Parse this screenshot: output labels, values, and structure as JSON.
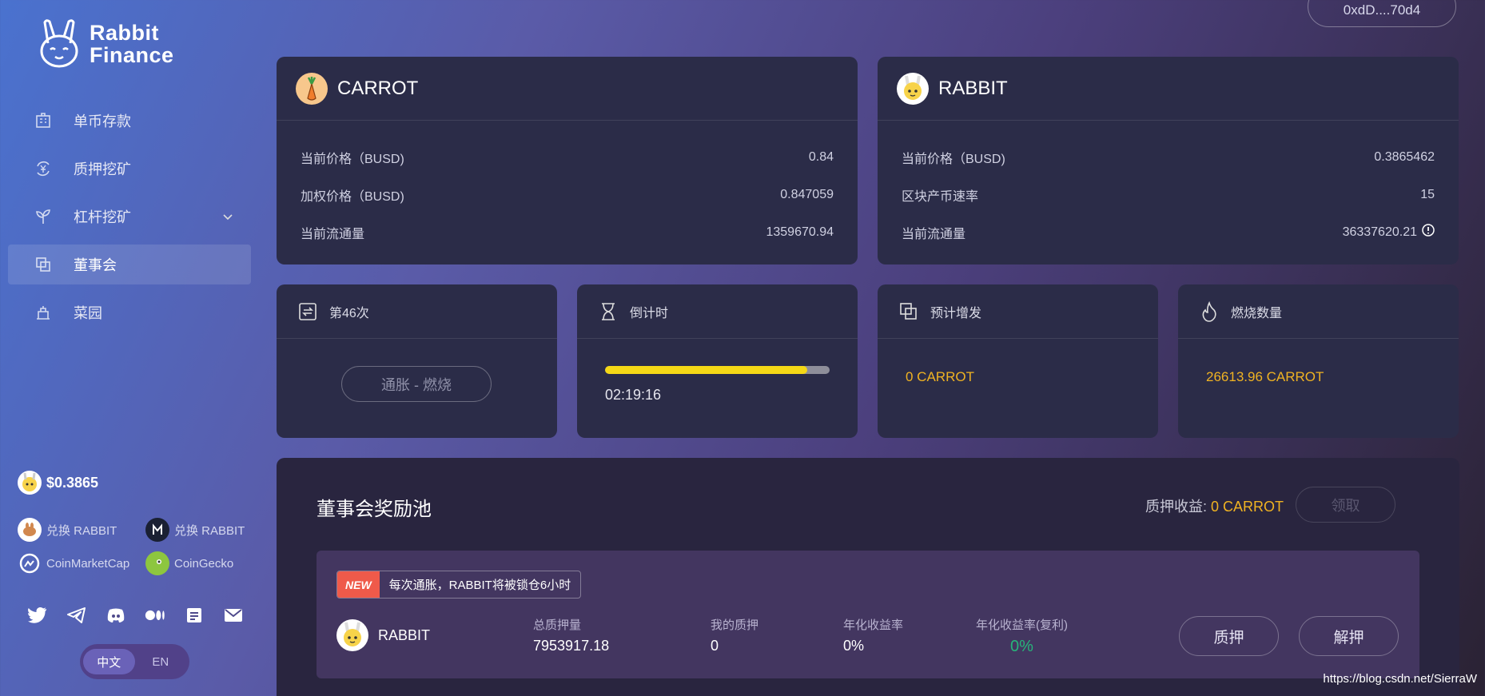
{
  "brand": {
    "name_line1": "Rabbit",
    "name_line2": "Finance"
  },
  "wallet": {
    "address": "0xdD....70d4"
  },
  "nav": {
    "items": [
      {
        "label": "单币存款",
        "icon": "bank-icon"
      },
      {
        "label": "质押挖矿",
        "icon": "yen-exchange-icon"
      },
      {
        "label": "杠杆挖矿",
        "icon": "sprout-icon"
      },
      {
        "label": "董事会",
        "icon": "squares-icon"
      },
      {
        "label": "菜园",
        "icon": "garden-icon"
      }
    ]
  },
  "sidebar": {
    "price": "$0.3865",
    "links": [
      {
        "label": "兑换 RABBIT",
        "icon": "pancakeswap-icon"
      },
      {
        "label": "兑换 RABBIT",
        "icon": "mdex-icon"
      },
      {
        "label": "CoinMarketCap",
        "icon": "coinmarketcap-icon"
      },
      {
        "label": "CoinGecko",
        "icon": "coingecko-icon"
      }
    ],
    "socials": [
      "twitter-icon",
      "telegram-icon",
      "discord-icon",
      "medium-icon",
      "docs-icon",
      "mail-icon"
    ],
    "lang": {
      "zh": "中文",
      "en": "EN",
      "active": "zh"
    }
  },
  "carrot": {
    "title": "CARROT",
    "rows": [
      {
        "label": "当前价格（BUSD)",
        "value": "0.84"
      },
      {
        "label": "加权价格（BUSD)",
        "value": "0.847059"
      },
      {
        "label": "当前流通量",
        "value": "1359670.94"
      }
    ]
  },
  "rabbit": {
    "title": "RABBIT",
    "rows": [
      {
        "label": "当前价格（BUSD)",
        "value": "0.3865462"
      },
      {
        "label": "区块产币速率",
        "value": "15"
      },
      {
        "label": "当前流通量",
        "value": "36337620.21"
      }
    ]
  },
  "round": {
    "title": "第46次",
    "button": "通胀 - 燃烧"
  },
  "countdown": {
    "title": "倒计时",
    "time": "02:19:16",
    "progress": 0.9
  },
  "expected": {
    "title": "预计增发",
    "value": "0 CARROT"
  },
  "burn": {
    "title": "燃烧数量",
    "value": "26613.96 CARROT"
  },
  "pool": {
    "title": "董事会奖励池",
    "earn_label": "质押收益:",
    "earn_value": "0 CARROT",
    "claim": "领取",
    "badge": "NEW",
    "notice": "每次通胀，RABBIT将被锁仓6小时",
    "token": "RABBIT",
    "total_label": "总质押量",
    "total_value": "7953917.18",
    "mine_label": "我的质押",
    "mine_value": "0",
    "apr_label": "年化收益率",
    "apr_value": "0%",
    "apy_label": "年化收益率(复利)",
    "apy_value": "0%",
    "stake": "质押",
    "unstake": "解押"
  },
  "watermark": "https://blog.csdn.net/SierraW",
  "colors": {
    "gold": "#f0b322",
    "green": "#27b57a",
    "progress": "#f5d816",
    "badge": "#ef5a4a"
  }
}
